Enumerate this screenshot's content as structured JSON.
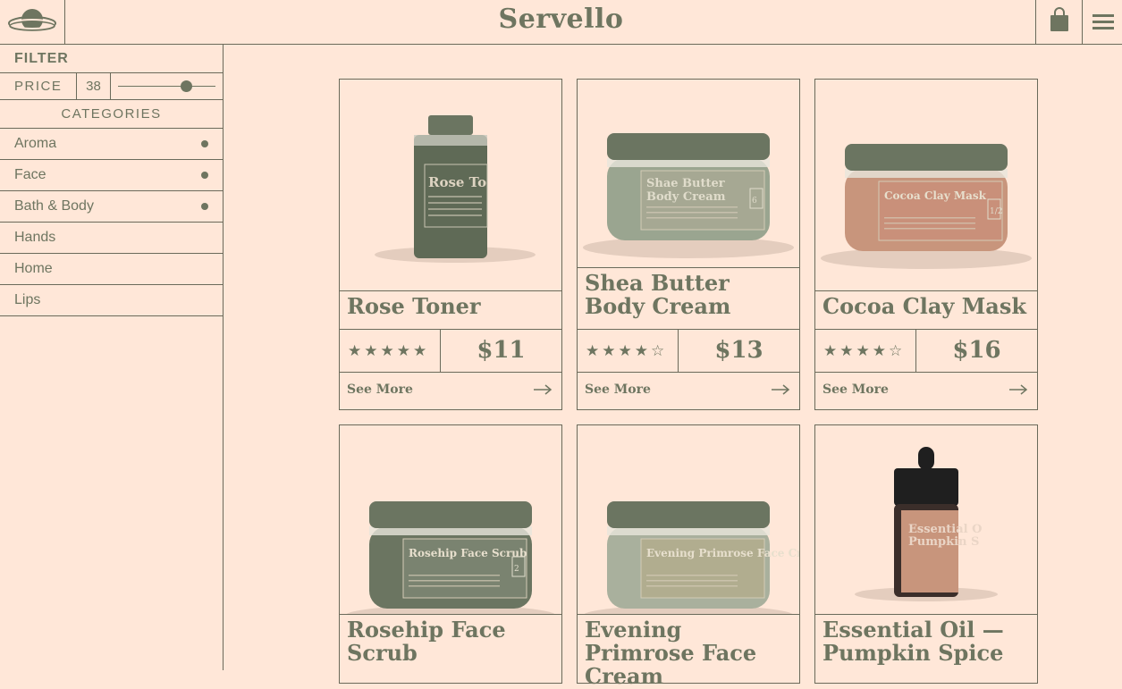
{
  "header": {
    "brand": "Servello",
    "logo_icon": "planet-logo-icon",
    "bag_icon": "shopping-bag-icon",
    "menu_icon": "hamburger-menu-icon"
  },
  "sidebar": {
    "filter_title": "FILTER",
    "price_label": "PRICE",
    "price_value": "38",
    "price_slider_fraction": 0.7,
    "categories_title": "CATEGORIES",
    "categories": [
      {
        "label": "Aroma",
        "dot": true
      },
      {
        "label": "Face",
        "dot": true
      },
      {
        "label": "Bath & Body",
        "dot": true
      },
      {
        "label": "Hands",
        "dot": false
      },
      {
        "label": "Home",
        "dot": false
      },
      {
        "label": "Lips",
        "dot": false
      }
    ]
  },
  "products": [
    {
      "name": "Rose Toner",
      "label_text": "Rose To",
      "rating": 5,
      "price": "$11",
      "see_more": "See More",
      "package": "bottle"
    },
    {
      "name": "Shea Butter Body Cream",
      "label_text": "Shae Butter Body Cream",
      "label_number": "6",
      "rating": 4,
      "price": "$13",
      "see_more": "See More",
      "package": "jar"
    },
    {
      "name": "Cocoa Clay Mask",
      "label_text": "Cocoa Clay Mask",
      "label_number": "1/2",
      "rating": 4,
      "price": "$16",
      "see_more": "See More",
      "package": "jar"
    },
    {
      "name": "Rosehip Face Scrub",
      "label_text": "Rosehip Face Scrub",
      "label_number": "2",
      "package": "jar"
    },
    {
      "name": "Evening Primrose Face Cream",
      "label_text": "Evening Primrose Face Cr",
      "package": "jar"
    },
    {
      "name": "Essential Oil — Pumpkin Spice",
      "label_text": "Essential O Pumpkin S",
      "package": "dropper"
    }
  ],
  "colors": {
    "background": "#ffe7d8",
    "accent": "#6e7560",
    "olive": "#6b7561",
    "sage": "#9aa590",
    "terracotta": "#c8957c"
  }
}
